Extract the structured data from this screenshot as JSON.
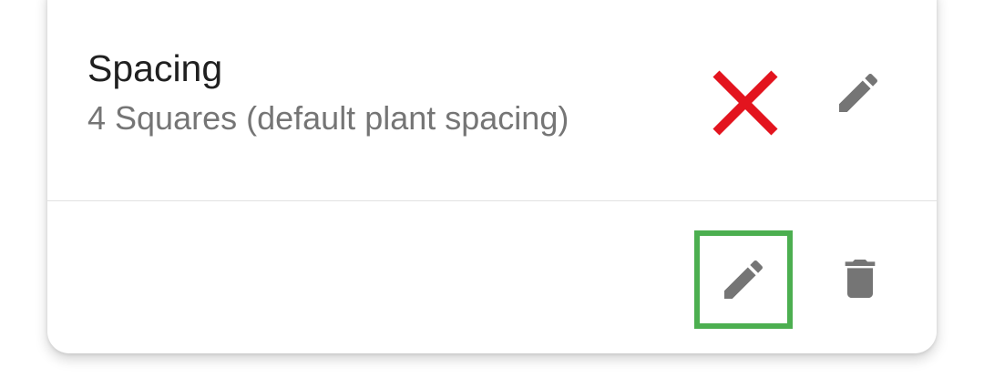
{
  "setting": {
    "title": "Spacing",
    "value": "4 Squares (default plant spacing)"
  },
  "icons": {
    "annotation_mark": "close-x-icon",
    "row_edit": "pencil-icon",
    "action_edit": "pencil-icon",
    "action_delete": "trash-icon"
  },
  "colors": {
    "annotation_mark": "#e3141e",
    "highlight_border": "#4caf50",
    "icon": "#757575",
    "title_text": "#202020",
    "subtitle_text": "#757575"
  }
}
